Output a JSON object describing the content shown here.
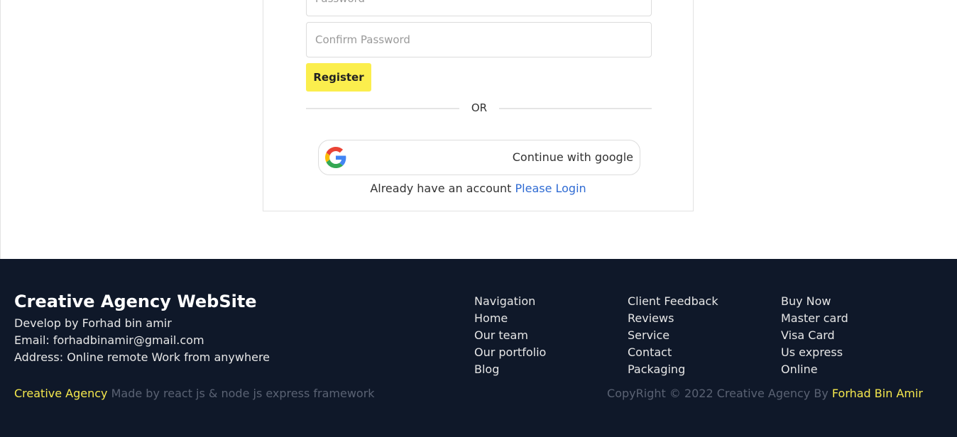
{
  "form": {
    "password_placeholder": "Password",
    "confirm_placeholder": "Confirm Password",
    "register_label": "Register",
    "or_label": "OR",
    "google_label": "Continue with google",
    "account_text": "Already have an account",
    "login_link": "Please Login"
  },
  "footer": {
    "title": "Creative Agency WebSite",
    "developer": "Develop by Forhad bin amir",
    "email": "Email: forhadbinamir@gmail.com",
    "address": "Address: Online remote Work from anywhere",
    "columns": [
      [
        "Navigation",
        "Home",
        "Our team",
        "Our portfolio",
        "Blog"
      ],
      [
        "Client Feedback",
        "Reviews",
        "Service",
        "Contact",
        "Packaging"
      ],
      [
        "Buy Now",
        "Master card",
        "Visa Card",
        "Us express",
        "Online"
      ]
    ],
    "brand_highlight": "Creative Agency",
    "made_by": "Made by react js & node js express framework",
    "copyright": "CopyRight © 2022 Creative Agency By",
    "author": "Forhad Bin Amir"
  },
  "colors": {
    "accent_yellow": "#fbee4d",
    "footer_bg": "#0f1829",
    "link_blue": "#2f6bd3"
  },
  "icons": {
    "google": "google-icon"
  }
}
